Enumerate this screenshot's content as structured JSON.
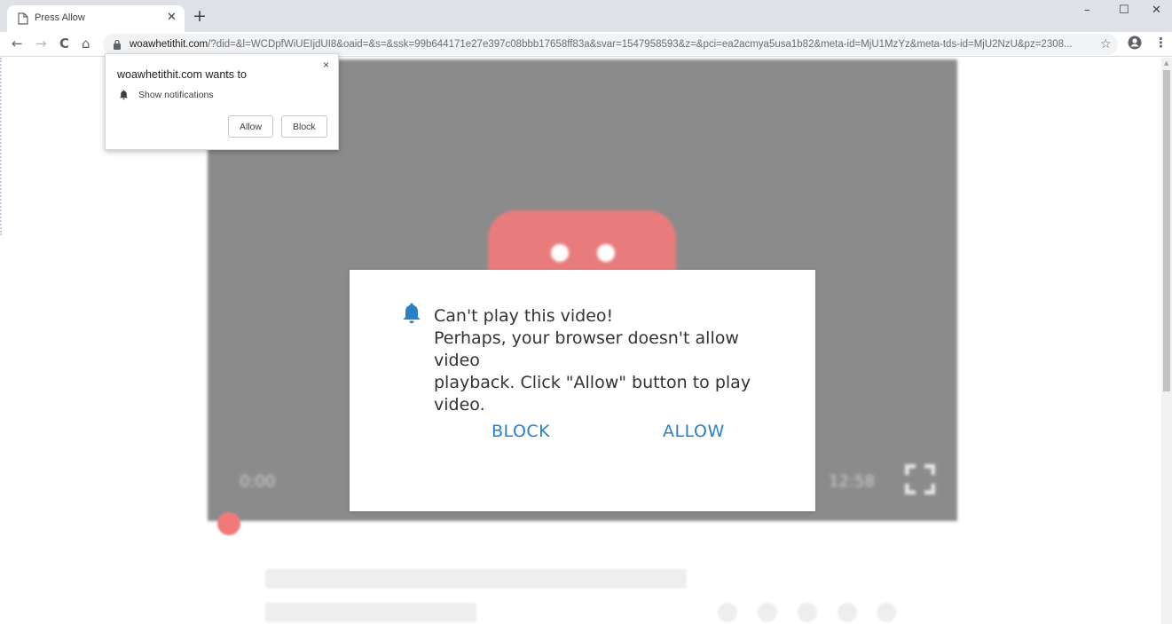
{
  "browser": {
    "tab": {
      "title": "Press Allow",
      "close_glyph": "✕",
      "icon": "page-icon"
    },
    "new_tab_glyph": "+",
    "window_controls": {
      "minimize": "–",
      "maximize": "☐",
      "close": "✕"
    },
    "nav": {
      "back": "←",
      "forward": "→",
      "reload": "C",
      "home": "⌂"
    },
    "address": {
      "host": "woawhetithit.com",
      "path": "/?did=&l=WCDpfWiUEIjdUI8&oaid=&s=&ssk=99b644171e27e397c08bbb17658ff83a&svar=1547958593&z=&pci=ea2acmya5usa1b82&meta-id=MjU1MzYz&meta-tds-id=MjU2NzU&pz=2308..."
    },
    "star_glyph": "☆",
    "menu_glyph": "⋮"
  },
  "video": {
    "time_start": "0:00",
    "time_end": "12:58",
    "logo_color": "#e87c7c",
    "bg_color": "#8b8b8b"
  },
  "dialog": {
    "message_lines": [
      "Can't play this video!",
      "Perhaps, your browser doesn't allow video",
      "playback. Click \"Allow\" button to play",
      "video."
    ],
    "block_label": "BLOCK",
    "allow_label": "ALLOW",
    "accent_color": "#2a80c7"
  },
  "permission_prompt": {
    "title": "woawhetithit.com wants to",
    "item": "Show notifications",
    "allow_label": "Allow",
    "block_label": "Block",
    "close_glyph": "×"
  }
}
